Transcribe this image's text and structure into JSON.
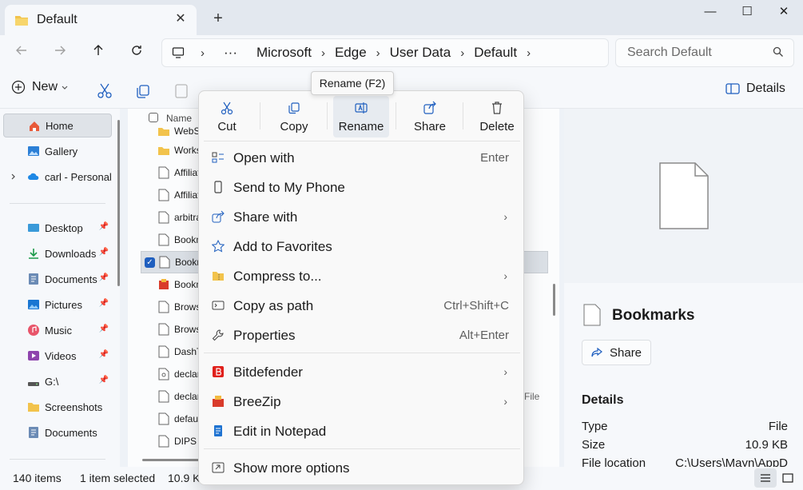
{
  "window": {
    "tab_title": "Default",
    "tab_close": "✕",
    "new_tab": "+",
    "minimize": "—",
    "maximize": "☐",
    "close": "✕"
  },
  "address": {
    "more": "···",
    "crumbs": [
      "Microsoft",
      "Edge",
      "User Data",
      "Default"
    ],
    "sep": "›"
  },
  "search": {
    "placeholder": "Search Default"
  },
  "toolbar": {
    "new_label": "New",
    "details_label": "Details"
  },
  "tooltip": "Rename (F2)",
  "sidebar": {
    "items": [
      {
        "label": "Home"
      },
      {
        "label": "Gallery"
      },
      {
        "label": "carl - Personal"
      },
      {
        "label": "Desktop"
      },
      {
        "label": "Downloads"
      },
      {
        "label": "Documents"
      },
      {
        "label": "Pictures"
      },
      {
        "label": "Music"
      },
      {
        "label": "Videos"
      },
      {
        "label": "G:\\"
      },
      {
        "label": "Screenshots"
      },
      {
        "label": "Documents"
      }
    ]
  },
  "filelist": {
    "name_header": "Name",
    "rows": [
      "WebSt",
      "Works",
      "Affiliat",
      "Affiliat",
      "arbitra",
      "Bookm",
      "Bookm",
      "Bookm",
      "Browsi",
      "Browsi",
      "DashTr",
      "declara",
      "declara",
      "defaul",
      "DIPS"
    ],
    "type_fragment": "File"
  },
  "context_menu": {
    "quick_actions": [
      {
        "label": "Cut"
      },
      {
        "label": "Copy"
      },
      {
        "label": "Rename"
      },
      {
        "label": "Share"
      },
      {
        "label": "Delete"
      }
    ],
    "items": [
      {
        "label": "Open with",
        "shortcut": "Enter"
      },
      {
        "label": "Send to My Phone",
        "shortcut": ""
      },
      {
        "label": "Share with",
        "shortcut": ""
      },
      {
        "label": "Add to Favorites",
        "shortcut": ""
      },
      {
        "label": "Compress to...",
        "shortcut": ""
      },
      {
        "label": "Copy as path",
        "shortcut": "Ctrl+Shift+C"
      },
      {
        "label": "Properties",
        "shortcut": "Alt+Enter"
      },
      {
        "label": "Bitdefender",
        "shortcut": ""
      },
      {
        "label": "BreeZip",
        "shortcut": ""
      },
      {
        "label": "Edit in Notepad",
        "shortcut": ""
      },
      {
        "label": "Show more options",
        "shortcut": ""
      }
    ]
  },
  "details": {
    "title": "Bookmarks",
    "share_label": "Share",
    "section": "Details",
    "rows": [
      {
        "key": "Type",
        "value": "File"
      },
      {
        "key": "Size",
        "value": "10.9 KB"
      },
      {
        "key": "File location",
        "value": "C:\\Users\\Mayn\\AppD"
      }
    ]
  },
  "status": {
    "items": "140 items",
    "selected": "1 item selected",
    "size": "10.9 K"
  },
  "colors": {
    "accent": "#0067c0",
    "bitdefender": "#e0201b",
    "folder": "#f2c34c"
  }
}
